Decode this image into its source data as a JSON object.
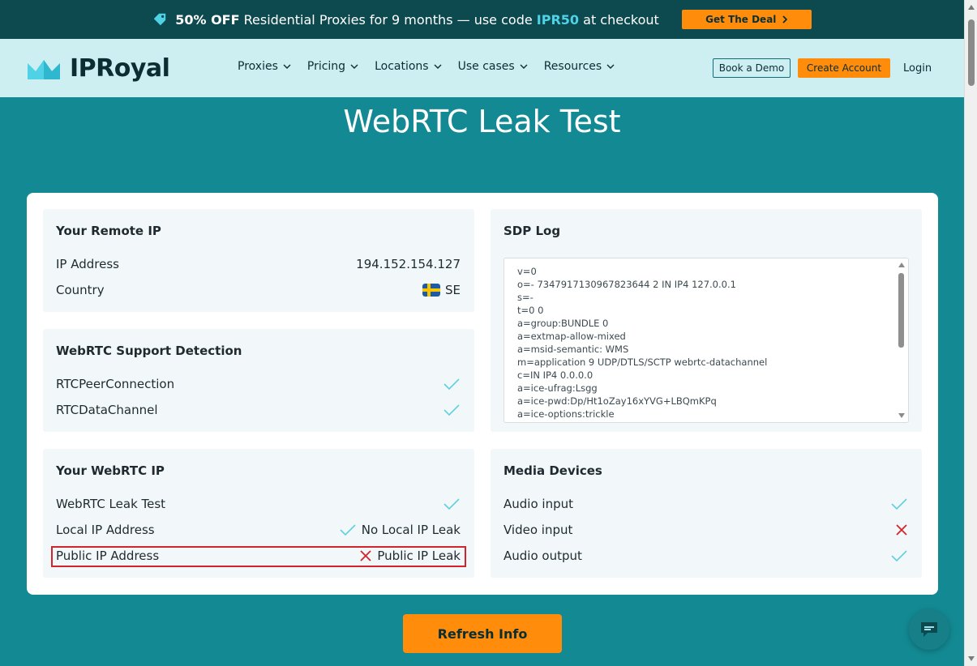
{
  "promo": {
    "bold_part": "50% OFF",
    "text_before_code": " Residential Proxies for 9 months — use code ",
    "code": "IPR50",
    "text_after_code": " at checkout",
    "cta_label": "Get The Deal"
  },
  "nav": {
    "brand": "IPRoyal",
    "menu": [
      {
        "label": "Proxies"
      },
      {
        "label": "Pricing"
      },
      {
        "label": "Locations"
      },
      {
        "label": "Use cases"
      },
      {
        "label": "Resources"
      }
    ],
    "book_demo": "Book a Demo",
    "create_account": "Create Account",
    "login": "Login"
  },
  "page_title": "WebRTC Leak Test",
  "remote_ip": {
    "title": "Your Remote IP",
    "ip_label": "IP Address",
    "ip_value": "194.152.154.127",
    "country_label": "Country",
    "country_value": "SE"
  },
  "support": {
    "title": "WebRTC Support Detection",
    "rows": [
      {
        "label": "RTCPeerConnection",
        "status": "ok"
      },
      {
        "label": "RTCDataChannel",
        "status": "ok"
      }
    ]
  },
  "webrtc_ip": {
    "title": "Your WebRTC IP",
    "leak_test_label": "WebRTC Leak Test",
    "local_label": "Local IP Address",
    "local_value": "No Local IP Leak",
    "public_label": "Public IP Address",
    "public_value": "Public IP Leak"
  },
  "sdp": {
    "title": "SDP Log",
    "lines": [
      "v=0",
      "o=- 7347917130967823644 2 IN IP4 127.0.0.1",
      "s=-",
      "t=0 0",
      "a=group:BUNDLE 0",
      "a=extmap-allow-mixed",
      "a=msid-semantic: WMS",
      "m=application 9 UDP/DTLS/SCTP webrtc-datachannel",
      "c=IN IP4 0.0.0.0",
      "a=ice-ufrag:Lsgg",
      "a=ice-pwd:Dp/Ht1oZay16xYVG+LBQmKPq",
      "a=ice-options:trickle"
    ]
  },
  "media": {
    "title": "Media Devices",
    "rows": [
      {
        "label": "Audio input",
        "status": "ok"
      },
      {
        "label": "Video input",
        "status": "fail"
      },
      {
        "label": "Audio output",
        "status": "ok"
      }
    ]
  },
  "refresh_label": "Refresh Info",
  "colors": {
    "accent": "#ff8c0a",
    "teal": "#138a93",
    "check": "#5fd0e0",
    "cross": "#d3232b"
  }
}
